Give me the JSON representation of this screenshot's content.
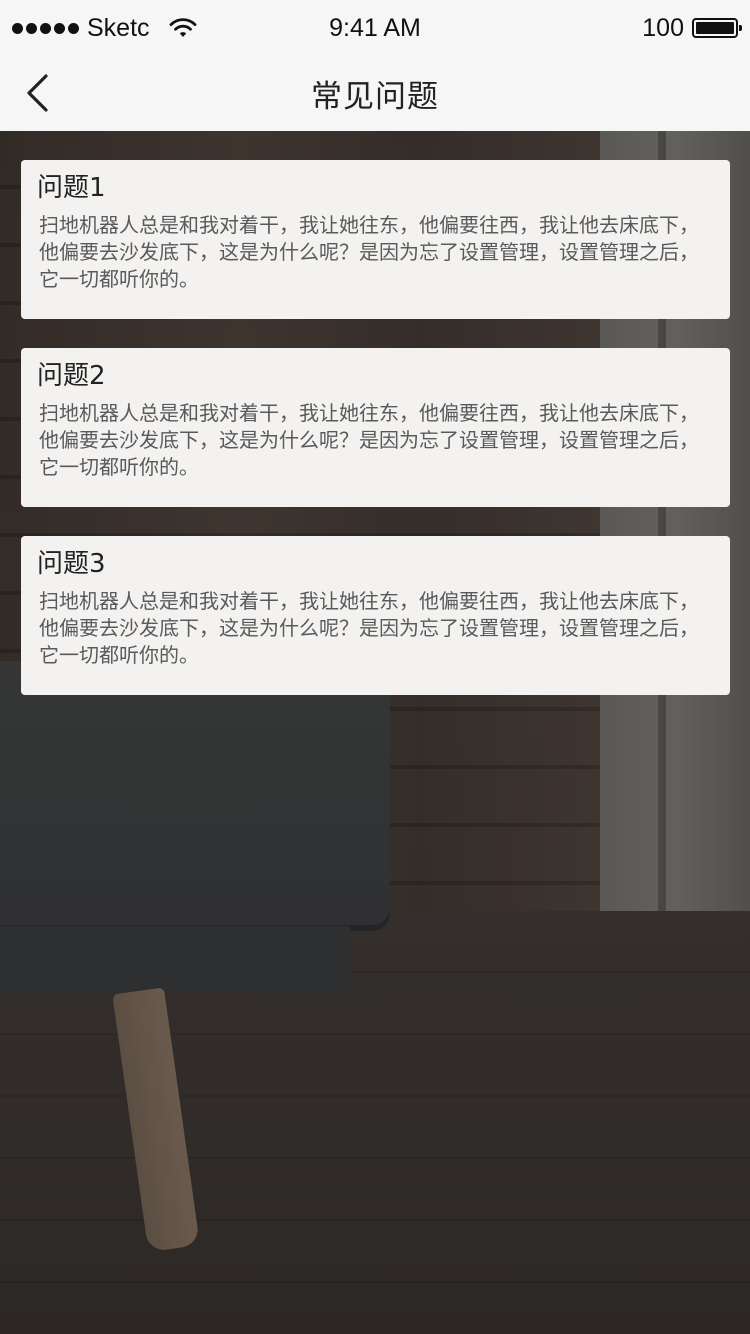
{
  "status_bar": {
    "carrier": "Sketc",
    "time": "9:41 AM",
    "battery": "100"
  },
  "nav": {
    "title": "常见问题",
    "back_icon": "chevron-left-icon"
  },
  "faq": [
    {
      "title": "问题1",
      "body": "扫地机器人总是和我对着干，我让她往东，他偏要往西，我让他去床底下，他偏要去沙发底下，这是为什么呢？是因为忘了设置管理，设置管理之后，它一切都听你的。"
    },
    {
      "title": "问题2",
      "body": "扫地机器人总是和我对着干，我让她往东，他偏要往西，我让他去床底下，他偏要去沙发底下，这是为什么呢？是因为忘了设置管理，设置管理之后，它一切都听你的。"
    },
    {
      "title": "问题3",
      "body": "扫地机器人总是和我对着干，我让她往东，他偏要往西，我让他去床底下，他偏要去沙发底下，这是为什么呢？是因为忘了设置管理，设置管理之后，它一切都听你的。"
    }
  ]
}
